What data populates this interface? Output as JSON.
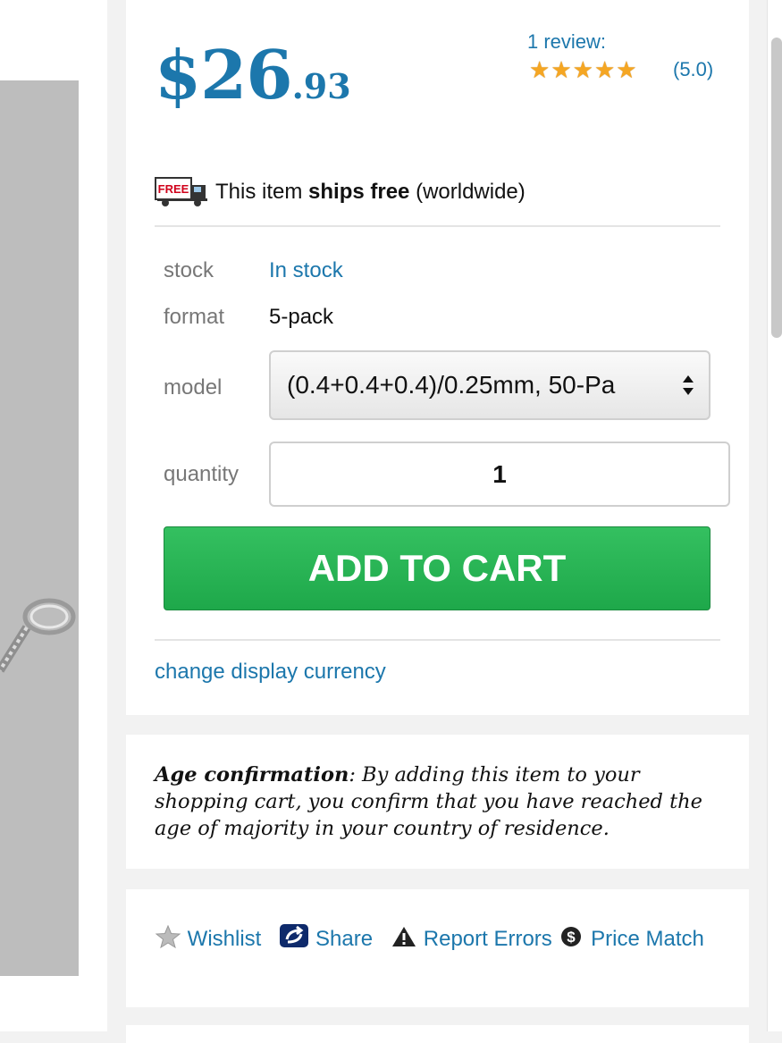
{
  "price": {
    "dollars": "$26",
    "cents": ".93"
  },
  "review": {
    "link_text": "1 review:",
    "rating": 5,
    "rating_text": "(5.0)"
  },
  "shipping": {
    "badge": "FREE",
    "text_before": "This item ",
    "text_strong": "ships free",
    "text_after": " (worldwide)"
  },
  "details": {
    "stock_label": "stock",
    "stock_value": "In stock",
    "format_label": "format",
    "format_value": "5-pack",
    "model_label": "model",
    "model_value": "(0.4+0.4+0.4)/0.25mm, 50-Pa",
    "quantity_label": "quantity",
    "quantity_value": "1"
  },
  "cart": {
    "button_label": "ADD TO CART"
  },
  "currency": {
    "link_text": "change display currency"
  },
  "age": {
    "strong": "Age confirmation",
    "text": ": By adding this item to your shopping cart, you confirm that you have reached the age of majority in your country of residence."
  },
  "actions": {
    "wishlist": "Wishlist",
    "share": "Share",
    "report": "Report Errors",
    "price_match": "Price Match"
  },
  "colors": {
    "link": "#1c77ac",
    "cart_button": "#26b354",
    "star": "#f5a623"
  }
}
